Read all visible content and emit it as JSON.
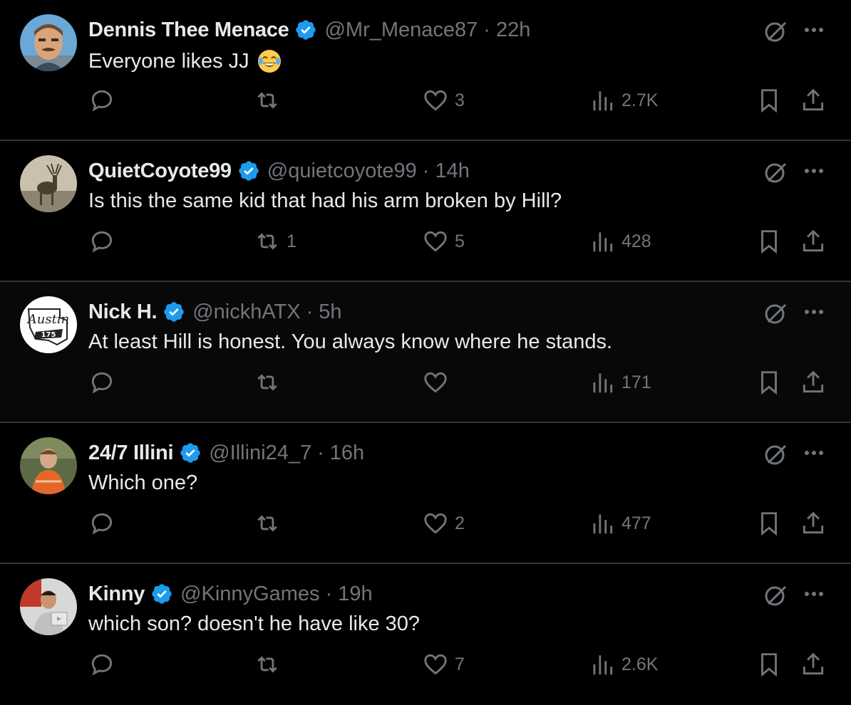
{
  "colors": {
    "background": "#000000",
    "text": "#e7e9ea",
    "muted": "#71767b",
    "verified": "#1d9bf0",
    "divider": "#2f3336"
  },
  "posts": [
    {
      "name": "Dennis Thee Menace",
      "handle": "@Mr_Menace87",
      "time": "22h",
      "text": "Everyone likes JJ",
      "emoji": "face-with-tears-of-joy",
      "replies": "",
      "reposts": "",
      "likes": "3",
      "views": "2.7K",
      "avatar": "cartoon-man-avatar"
    },
    {
      "name": "QuietCoyote99",
      "handle": "@quietcoyote99",
      "time": "14h",
      "text": "Is this the same kid that had his arm broken by Hill?",
      "replies": "",
      "reposts": "1",
      "likes": "5",
      "views": "428",
      "avatar": "stag-photo-avatar"
    },
    {
      "name": "Nick H.",
      "handle": "@nickhATX",
      "time": "5h",
      "text": "At least Hill is honest. You always know where he stands.",
      "replies": "",
      "reposts": "",
      "likes": "",
      "views": "171",
      "avatar": "austin-logo-avatar"
    },
    {
      "name": "24/7 Illini",
      "handle": "@Illini24_7",
      "time": "16h",
      "text": "Which one?",
      "replies": "",
      "reposts": "",
      "likes": "2",
      "views": "477",
      "avatar": "person-orange-jersey-avatar"
    },
    {
      "name": "Kinny",
      "handle": "@KinnyGames",
      "time": "19h",
      "text": "which son? doesn't he have like 30?",
      "replies": "",
      "reposts": "",
      "likes": "7",
      "views": "2.6K",
      "avatar": "person-with-plaque-avatar"
    }
  ],
  "austin_logo": {
    "word": "Austin",
    "number": "175"
  }
}
